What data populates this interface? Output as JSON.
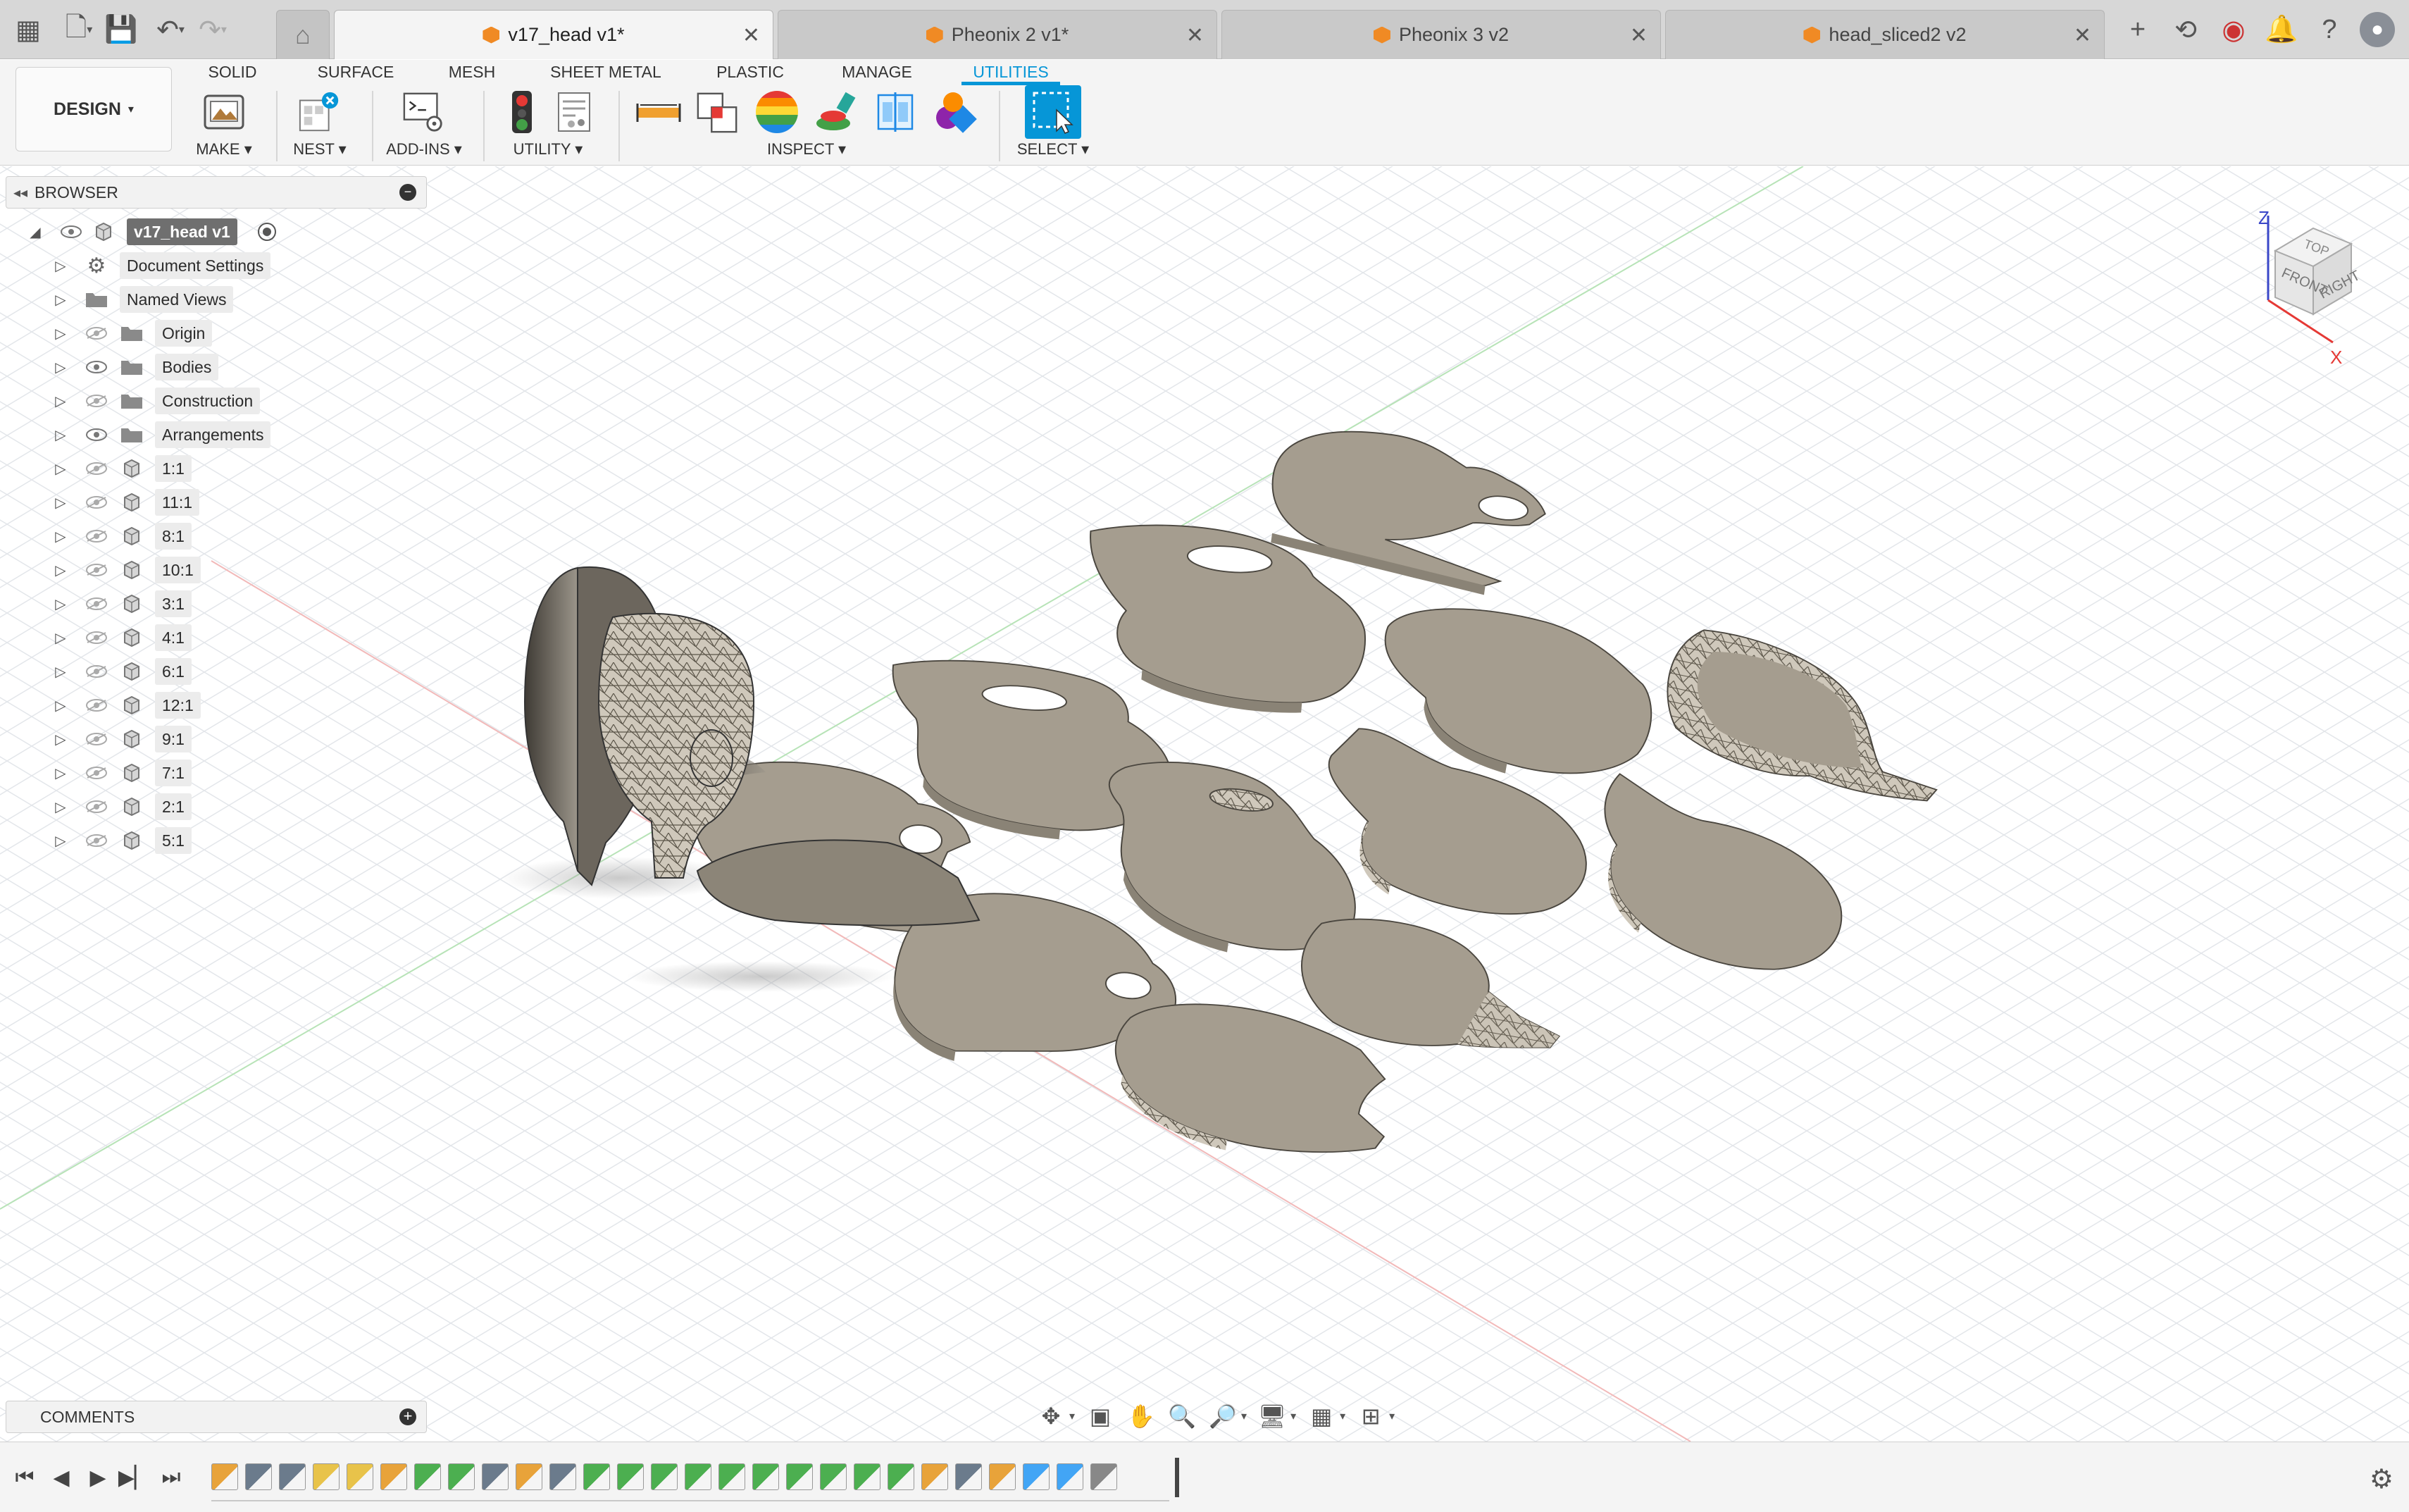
{
  "tabs": [
    {
      "label": "v17_head v1*",
      "active": true
    },
    {
      "label": "Pheonix 2 v1*",
      "active": false
    },
    {
      "label": "Pheonix 3 v2",
      "active": false
    },
    {
      "label": "head_sliced2 v2",
      "active": false
    }
  ],
  "workspace": {
    "label": "DESIGN"
  },
  "ribbon_tabs": [
    "SOLID",
    "SURFACE",
    "MESH",
    "SHEET METAL",
    "PLASTIC",
    "MANAGE",
    "UTILITIES"
  ],
  "active_ribbon_tab": "UTILITIES",
  "ribbon_groups": {
    "make": "MAKE",
    "nest": "NEST",
    "addins": "ADD-INS",
    "utility": "UTILITY",
    "inspect": "INSPECT",
    "select": "SELECT"
  },
  "browser": {
    "title": "BROWSER",
    "root": "v17_head v1",
    "items": [
      {
        "label": "Document Settings",
        "icon": "gear-icon",
        "eye": false
      },
      {
        "label": "Named Views",
        "icon": "folder-icon",
        "eye": false
      },
      {
        "label": "Origin",
        "icon": "folder-icon",
        "eye": true,
        "visible": false
      },
      {
        "label": "Bodies",
        "icon": "folder-icon",
        "eye": true,
        "visible": true
      },
      {
        "label": "Construction",
        "icon": "folder-icon",
        "eye": true,
        "visible": false
      },
      {
        "label": "Arrangements",
        "icon": "folder-icon",
        "eye": true,
        "visible": true
      },
      {
        "label": "1:1",
        "icon": "component-icon",
        "eye": true,
        "visible": false
      },
      {
        "label": "11:1",
        "icon": "component-icon",
        "eye": true,
        "visible": false
      },
      {
        "label": "8:1",
        "icon": "component-icon",
        "eye": true,
        "visible": false
      },
      {
        "label": "10:1",
        "icon": "component-icon",
        "eye": true,
        "visible": false
      },
      {
        "label": "3:1",
        "icon": "component-icon",
        "eye": true,
        "visible": false
      },
      {
        "label": "4:1",
        "icon": "component-icon",
        "eye": true,
        "visible": false
      },
      {
        "label": "6:1",
        "icon": "component-icon",
        "eye": true,
        "visible": false
      },
      {
        "label": "12:1",
        "icon": "component-icon",
        "eye": true,
        "visible": false
      },
      {
        "label": "9:1",
        "icon": "component-icon",
        "eye": true,
        "visible": false
      },
      {
        "label": "7:1",
        "icon": "component-icon",
        "eye": true,
        "visible": false
      },
      {
        "label": "2:1",
        "icon": "component-icon",
        "eye": true,
        "visible": false
      },
      {
        "label": "5:1",
        "icon": "component-icon",
        "eye": true,
        "visible": false
      }
    ]
  },
  "comments": {
    "title": "COMMENTS"
  },
  "viewcube": {
    "top": "TOP",
    "front": "FRONT",
    "right": "RIGHT",
    "axis_z": "Z",
    "axis_x": "X"
  },
  "colors": {
    "accent": "#0696d7",
    "slice": "#a59d8f",
    "slice_edge": "#6e6759",
    "tab_icon": "#f08a24"
  }
}
